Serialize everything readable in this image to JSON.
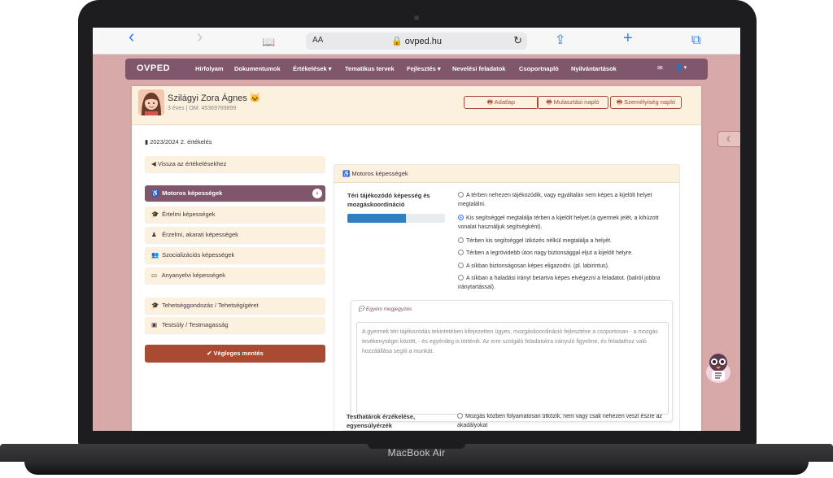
{
  "device": {
    "label": "MacBook Air"
  },
  "browser": {
    "back_icon": "‹",
    "forward_icon": "›",
    "book_icon": "📖",
    "aa": "AA",
    "url": "🔒 ovped.hu",
    "reload_icon": "↻",
    "share_icon": "⇪",
    "plus_icon": "+",
    "tabs_icon": "⧉"
  },
  "navbar": {
    "brand": "OVPED",
    "items": [
      "Hírfolyam",
      "Dokumentumok",
      "Értékelések ▾",
      "Tematikus tervek",
      "Fejlesztés ▾",
      "Nevelési feladatok",
      "Csoportnapló",
      "Nyilvántartások"
    ],
    "mail_icon": "✉",
    "user_icon": "👤 ▾"
  },
  "profile": {
    "name": "Szilágyi Zora Ágnes 🐱",
    "sub": "3 éves | OM: 45369789899",
    "buttons": [
      "🖶 Adatlap",
      "🖶 Mulasztási napló",
      "🖶 Személyiség napló"
    ]
  },
  "sidebar": {
    "period": "▮ 2023/2024 2. értékelés",
    "back": "◀ Vissza az értékelésekhez",
    "items": [
      {
        "icon": "♿",
        "label": "Motoros képességek"
      },
      {
        "icon": "🎓",
        "label": "Értelmi képességek"
      },
      {
        "icon": "♟",
        "label": "Érzelmi, akarati képességek"
      },
      {
        "icon": "👥",
        "label": "Szocializációs képességek"
      },
      {
        "icon": "▭",
        "label": "Anyanyelvi képességek"
      }
    ],
    "extra": [
      {
        "icon": "🎓",
        "label": "Tehetséggondozás / Tehetségígéret"
      },
      {
        "icon": "▣",
        "label": "Testsúly / Testmagasság"
      }
    ],
    "active_arrow": "›",
    "save": "✔ Végleges mentés"
  },
  "card": {
    "header": "♿ Motoros képességek",
    "skill1": {
      "label": "Téri tájékozódó képesség és mozgáskoordináció",
      "progress": 0.6,
      "options": [
        "A térben nehezen tájékozódik, vagy egyáltalán nem képes a kijelölt helyet megtalálni.",
        "Kis segítséggel megtalálja térben a kijelölt helyet.(a gyermek jelét, a kihúzott vonalat használjuk segítségként).",
        "Térben kis segítséggel ütközés nélkül megtalálja a helyét.",
        "Térben a legrövidebb úton nagy biztonsággal eljut a kijelölt helyre.",
        "A síkban biztonságosan képes eligazodni. (pl. labirintus).",
        "A síkban a haladási irányt betartva képes elvégezni a feladatot. (balról jobbra iránytartással)."
      ],
      "selected": 1
    },
    "note": {
      "title": "💬 Egyéni megjegyzés",
      "text": "A gyermek téri tájékozódás tekintetében kifejezetten ügyes, mozgáskoordináció fejlesztése a csoportosan - a mozgás tevékenységei között, - és egyénileg is történik. Az erre szolgáló feladatokra irányuló figyelme, és feladathoz való hozzáállása segíti a munkát."
    },
    "skill2": {
      "label": "Testhatárok érzékelése, egyensúlyérzék",
      "options": [
        "Mozgás közben folyamatosan ütközik, nem vagy csak nehezen veszi észre az akadályokat"
      ]
    }
  },
  "moon_icon": "☾",
  "colors": {
    "brand": "#80566d",
    "accent": "#a84b32",
    "cream": "#fbf1de",
    "page_bg": "#d7aaa9",
    "progress": "#2f7fc1"
  }
}
